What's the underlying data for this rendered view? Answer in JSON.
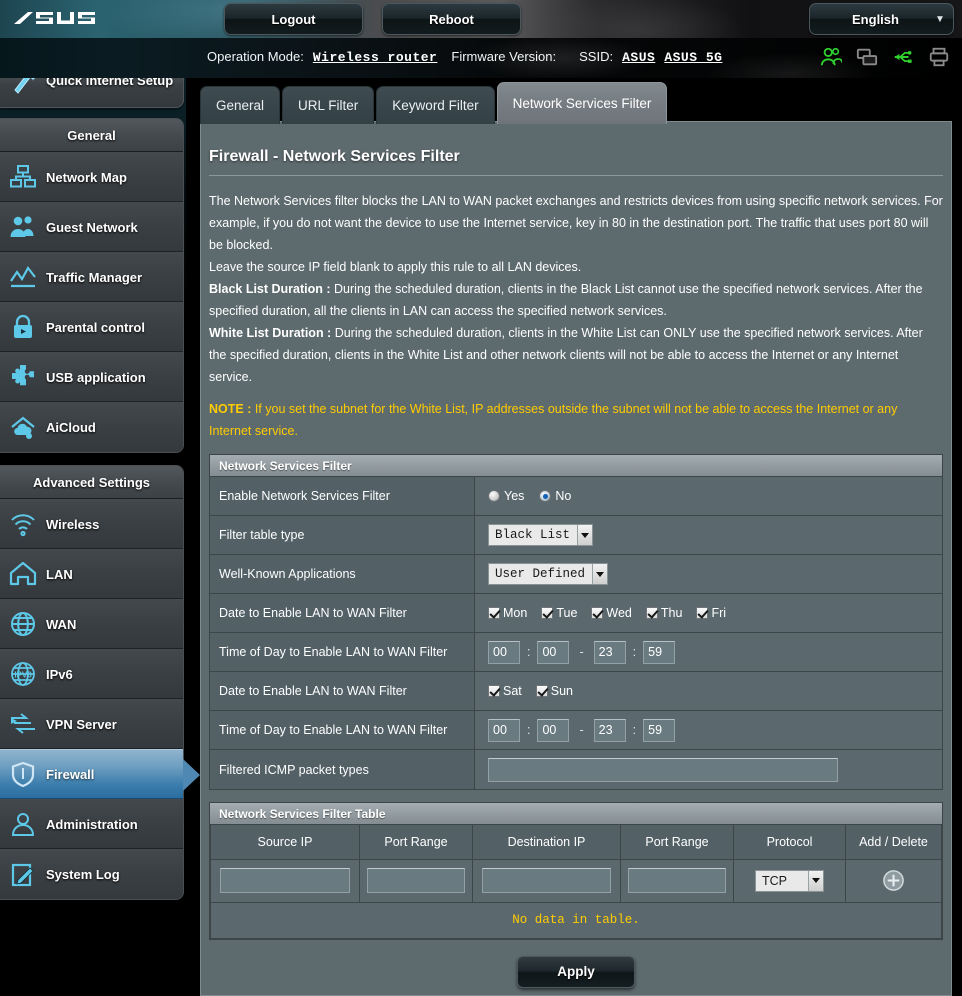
{
  "header": {
    "logo_text": "ASUS",
    "logout_label": "Logout",
    "reboot_label": "Reboot",
    "language": "English",
    "caret_icon": "chevron-down-icon"
  },
  "infobar": {
    "operation_mode_label": "Operation Mode:",
    "operation_mode_value": "Wireless router",
    "firmware_label": "Firmware Version:",
    "firmware_value": "",
    "ssid_label": "SSID:",
    "ssid_1": "ASUS",
    "ssid_2": "ASUS_5G",
    "status_icons": [
      {
        "name": "clients-icon",
        "color": "#33cc33"
      },
      {
        "name": "devices-icon",
        "color": "#808080"
      },
      {
        "name": "usb-icon",
        "color": "#33cc33"
      },
      {
        "name": "printer-icon",
        "color": "#808080"
      }
    ]
  },
  "sidebar": {
    "quick_setup_label": "Quick Internet Setup",
    "groups": [
      {
        "title": "General",
        "items": [
          {
            "label": "Network Map",
            "icon": "network-map-icon"
          },
          {
            "label": "Guest Network",
            "icon": "guest-network-icon"
          },
          {
            "label": "Traffic Manager",
            "icon": "traffic-manager-icon"
          },
          {
            "label": "Parental control",
            "icon": "parental-control-icon"
          },
          {
            "label": "USB application",
            "icon": "usb-application-icon"
          },
          {
            "label": "AiCloud",
            "icon": "aicloud-icon"
          }
        ]
      },
      {
        "title": "Advanced Settings",
        "items": [
          {
            "label": "Wireless",
            "icon": "wireless-icon"
          },
          {
            "label": "LAN",
            "icon": "lan-icon"
          },
          {
            "label": "WAN",
            "icon": "wan-icon"
          },
          {
            "label": "IPv6",
            "icon": "ipv6-icon"
          },
          {
            "label": "VPN Server",
            "icon": "vpn-server-icon"
          },
          {
            "label": "Firewall",
            "icon": "firewall-icon",
            "active": true
          },
          {
            "label": "Administration",
            "icon": "administration-icon"
          },
          {
            "label": "System Log",
            "icon": "system-log-icon"
          }
        ]
      }
    ]
  },
  "tabs": [
    {
      "label": "General",
      "active": false
    },
    {
      "label": "URL Filter",
      "active": false
    },
    {
      "label": "Keyword Filter",
      "active": false
    },
    {
      "label": "Network Services Filter",
      "active": true
    }
  ],
  "main": {
    "page_title": "Firewall - Network Services Filter",
    "desc_p1": "The Network Services filter blocks the LAN to WAN packet exchanges and restricts devices from using specific network services. For example, if you do not want the device to use the Internet service, key in 80 in the destination port. The traffic that uses port 80 will be blocked.",
    "desc_p2": "Leave the source IP field blank to apply this rule to all LAN devices.",
    "black_list_label": "Black List Duration :",
    "black_list_text": " During the scheduled duration, clients in the Black List cannot use the specified network services. After the specified duration, all the clients in LAN can access the specified network services.",
    "white_list_label": "White List Duration :",
    "white_list_text": " During the scheduled duration, clients in the White List can ONLY use the specified network services. After the specified duration, clients in the White List and other network clients will not be able to access the Internet or any Internet service.",
    "note_label": "NOTE :",
    "note_text": " If you set the subnet for the White List, IP addresses outside the subnet will not be able to access the Internet or any Internet service."
  },
  "settings": {
    "panel_title": "Network Services Filter",
    "enable_label": "Enable Network Services Filter",
    "enable_yes": "Yes",
    "enable_no": "No",
    "enable_value": "No",
    "filter_table_type_label": "Filter table type",
    "filter_table_type_value": "Black List",
    "well_known_label": "Well-Known Applications",
    "well_known_value": "User Defined",
    "date_label_1": "Date to Enable LAN to WAN Filter",
    "weekdays": [
      {
        "label": "Mon",
        "checked": true
      },
      {
        "label": "Tue",
        "checked": true
      },
      {
        "label": "Wed",
        "checked": true
      },
      {
        "label": "Thu",
        "checked": true
      },
      {
        "label": "Fri",
        "checked": true
      }
    ],
    "time_label_1": "Time of Day to Enable LAN to WAN Filter",
    "time_1": {
      "start_h": "00",
      "start_m": "00",
      "end_h": "23",
      "end_m": "59"
    },
    "date_label_2": "Date to Enable LAN to WAN Filter",
    "weekend": [
      {
        "label": "Sat",
        "checked": true
      },
      {
        "label": "Sun",
        "checked": true
      }
    ],
    "time_label_2": "Time of Day to Enable LAN to WAN Filter",
    "time_2": {
      "start_h": "00",
      "start_m": "00",
      "end_h": "23",
      "end_m": "59"
    },
    "icmp_label": "Filtered ICMP packet types",
    "icmp_value": ""
  },
  "filter_table": {
    "panel_title": "Network Services Filter Table",
    "columns": [
      "Source IP",
      "Port Range",
      "Destination IP",
      "Port Range",
      "Protocol",
      "Add / Delete"
    ],
    "input_row": {
      "source_ip": "",
      "port_range_1": "",
      "destination_ip": "",
      "port_range_2": "",
      "protocol": "TCP",
      "add_icon": "add-circle-icon"
    },
    "empty_message": "No data in table."
  },
  "apply_label": "Apply",
  "colors": {
    "accent_blue": "#3d7fae",
    "note_yellow": "#ffcc00",
    "icon_cyan": "#5ec8e8",
    "panel_bg": "#5d6a6e"
  }
}
